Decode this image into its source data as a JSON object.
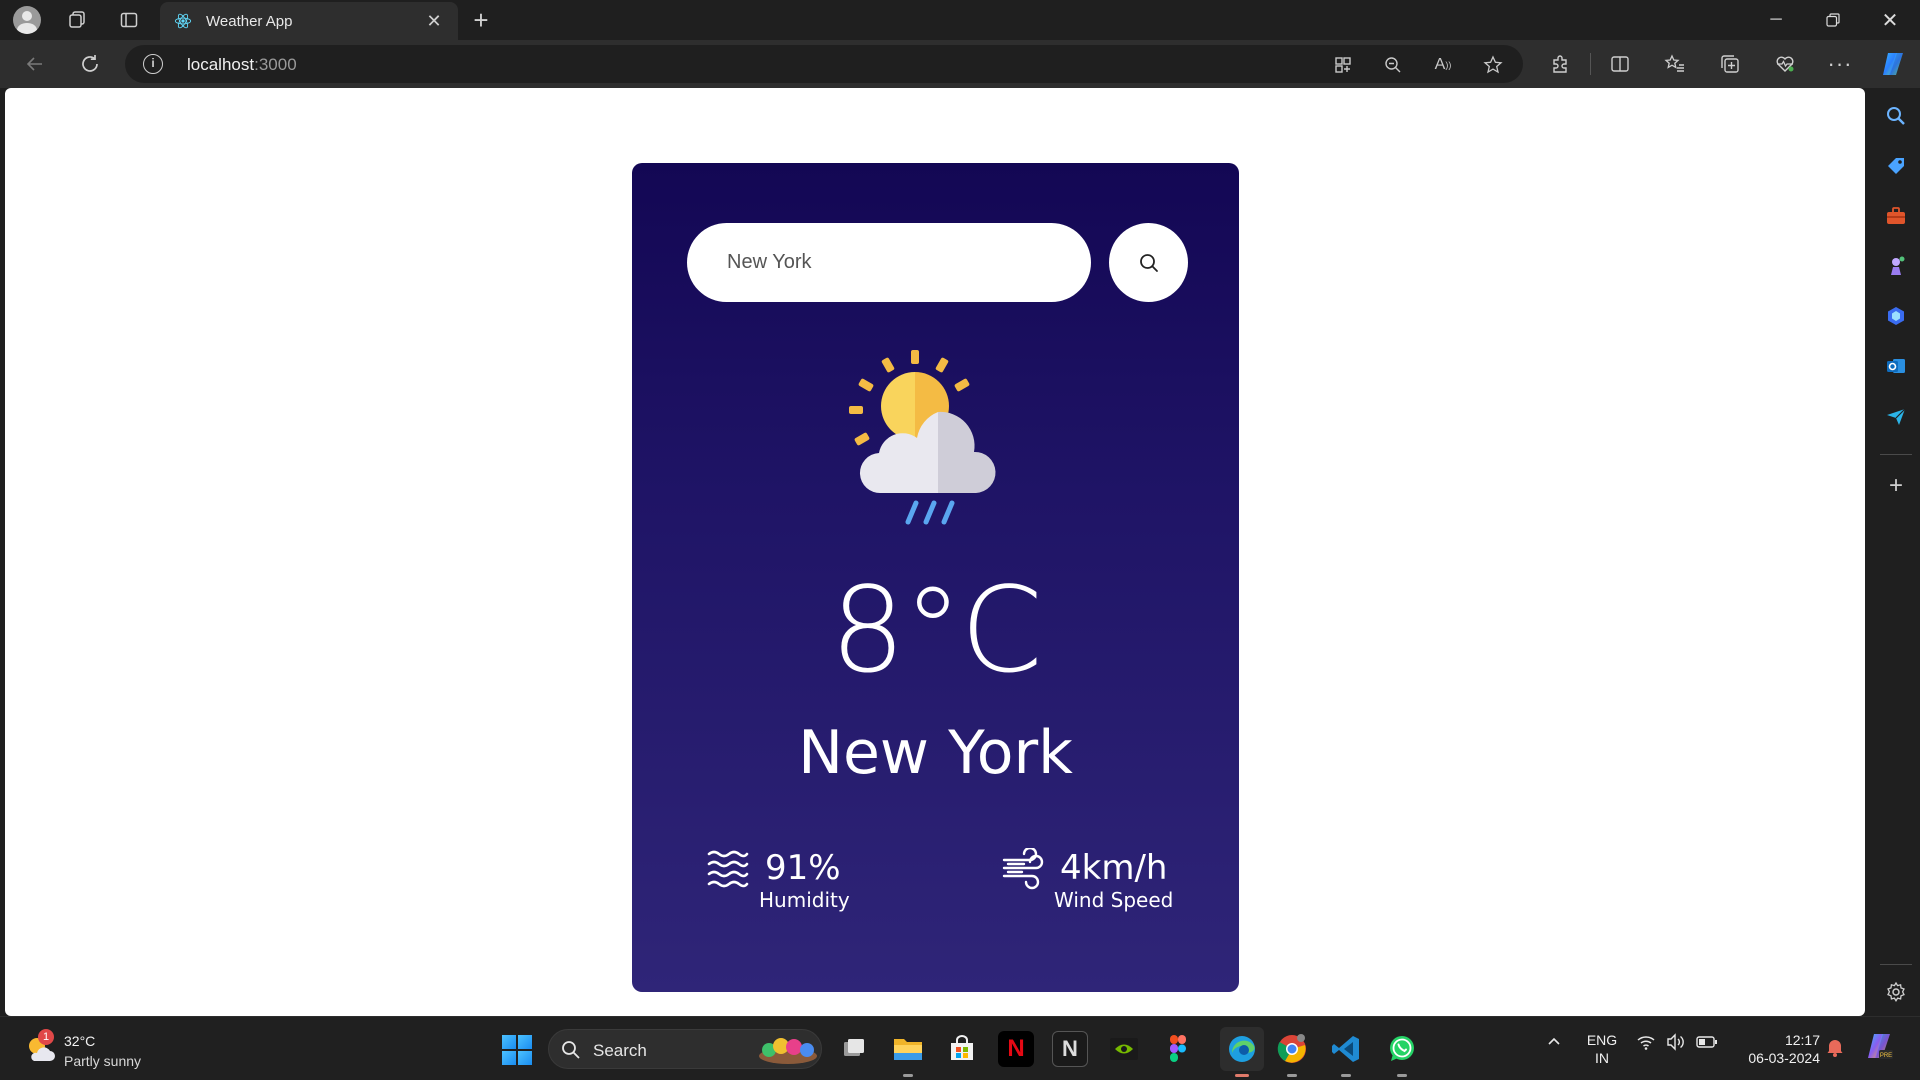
{
  "browser": {
    "tab_title": "Weather App",
    "url_host": "localhost",
    "url_port": ":3000"
  },
  "weather": {
    "search_value": "New York",
    "condition_icon": "sun-cloud-rain-icon",
    "temperature": "8°C",
    "city": "New York",
    "humidity_value": "91%",
    "humidity_label": "Humidity",
    "wind_value": "4km/h",
    "wind_label": "Wind Speed"
  },
  "taskbar": {
    "weather_temp": "32°C",
    "weather_desc": "Partly sunny",
    "weather_badge": "1",
    "search_label": "Search",
    "lang_line1": "ENG",
    "lang_line2": "IN",
    "time": "12:17",
    "date": "06-03-2024"
  },
  "colors": {
    "card_top": "#130754",
    "card_bottom": "#2f2578",
    "browser_bg": "#1f1f1f"
  }
}
